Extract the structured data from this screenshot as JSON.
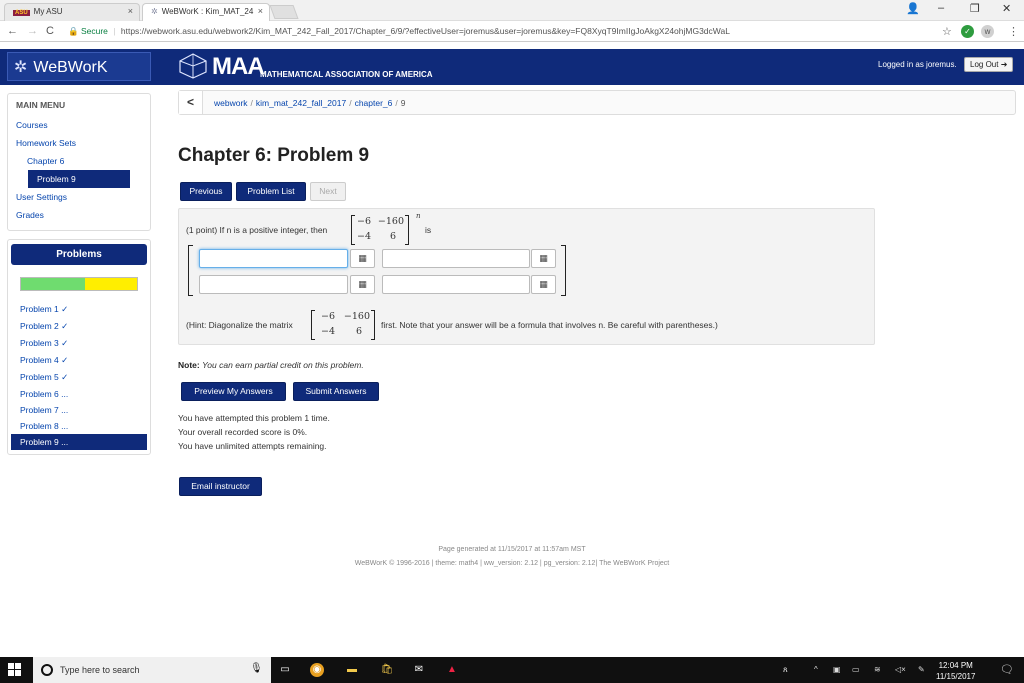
{
  "browser": {
    "tabs": [
      {
        "label": "My ASU",
        "close": "×"
      },
      {
        "label": "WeBWorK : Kim_MAT_24",
        "close": "×"
      }
    ],
    "window_controls": {
      "user": "👤",
      "minimize": "–",
      "restore": "❐",
      "close": "✕"
    },
    "nav": {
      "back": "←",
      "forward": "→",
      "reload": "C"
    },
    "secure_label": "Secure",
    "url": "https://webwork.asu.edu/webwork2/Kim_MAT_242_Fall_2017/Chapter_6/9/?effectiveUser=joremus&user=joremus&key=FQ8XyqT9ImIIgJoAkgX24ohjMG3dcWaL",
    "star": "☆",
    "menu": "⋮"
  },
  "header": {
    "logo": "WeBWorK",
    "maa_big": "MAA",
    "maa_small": "MATHEMATICAL ASSOCIATION OF AMERICA",
    "logged_in": "Logged in as joremus.",
    "logout": "Log Out"
  },
  "sidebar": {
    "menu_title": "MAIN MENU",
    "items": [
      {
        "label": "Courses"
      },
      {
        "label": "Homework Sets"
      },
      {
        "label": "Chapter 6"
      },
      {
        "label": "Problem 9"
      },
      {
        "label": "User Settings"
      },
      {
        "label": "Grades"
      }
    ],
    "problems_title": "Problems",
    "progress": {
      "correct_fraction": 0.55,
      "partial_fraction": 0.45,
      "correct_color": "#6fdc6f",
      "partial_color": "#ffee00"
    },
    "problems": [
      {
        "label": "Problem 1 ✓"
      },
      {
        "label": "Problem 2 ✓"
      },
      {
        "label": "Problem 3 ✓"
      },
      {
        "label": "Problem 4 ✓"
      },
      {
        "label": "Problem 5 ✓"
      },
      {
        "label": "Problem 6 ..."
      },
      {
        "label": "Problem 7 ..."
      },
      {
        "label": "Problem 8 ..."
      },
      {
        "label": "Problem 9 ..."
      }
    ]
  },
  "breadcrumb": {
    "back": "<",
    "parts": [
      "webwork",
      "kim_mat_242_fall_2017",
      "chapter_6",
      "9"
    ],
    "sep": "/"
  },
  "main": {
    "title": "Chapter 6: Problem 9",
    "buttons": {
      "previous": "Previous",
      "problem_list": "Problem List",
      "next": "Next"
    },
    "problem": {
      "prefix": "(1 point) If n is a positive integer, then",
      "matrix": [
        "−6",
        "−160",
        "−4",
        "6"
      ],
      "exponent": "n",
      "suffix": "is",
      "hint_prefix": "(Hint: Diagonalize the matrix",
      "hint_suffix": "first. Note that your answer will be a formula that involves n. Be careful with parentheses.)",
      "answer_button_glyph": "▦"
    },
    "note_label": "Note:",
    "note_text": "You can earn partial credit on this problem.",
    "preview_button": "Preview My Answers",
    "submit_button": "Submit Answers",
    "attempts": "You have attempted this problem 1 time.",
    "score": "Your overall recorded score is 0%.",
    "remaining": "You have unlimited attempts remaining.",
    "email_button": "Email instructor"
  },
  "footer": {
    "generated": "Page generated at 11/15/2017 at 11:57am MST",
    "version": "WeBWorK © 1996-2016 | theme: math4 | ww_version: 2.12 | pg_version: 2.12| The WeBWorK Project"
  },
  "taskbar": {
    "search_placeholder": "Type here to search",
    "time": "12:04 PM",
    "date": "11/15/2017"
  }
}
